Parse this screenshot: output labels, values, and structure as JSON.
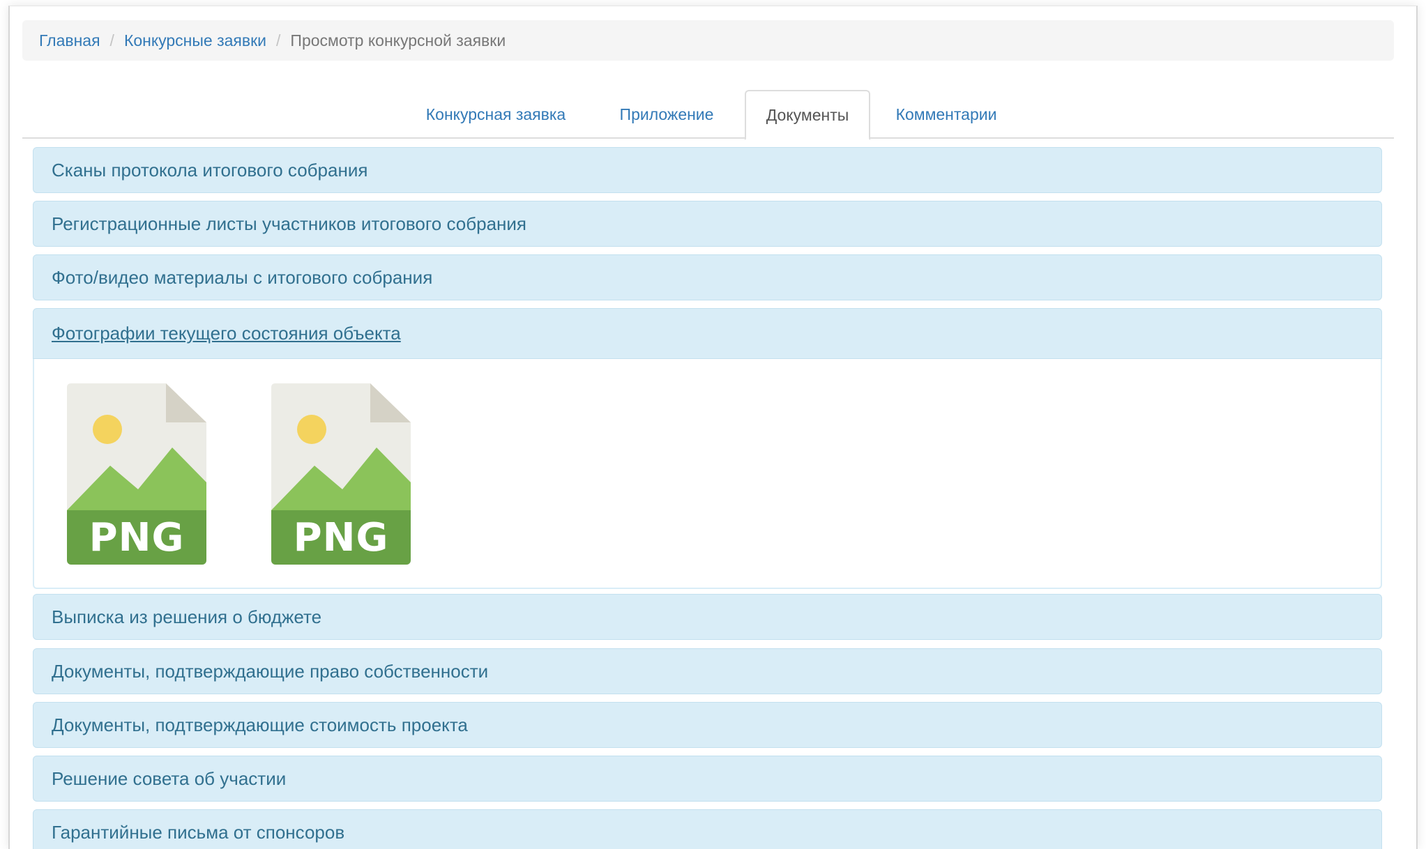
{
  "breadcrumb": {
    "home": "Главная",
    "applications": "Конкурсные заявки",
    "current": "Просмотр конкурсной заявки"
  },
  "tabs": [
    {
      "label": "Конкурсная заявка",
      "active": false
    },
    {
      "label": "Приложение",
      "active": false
    },
    {
      "label": "Документы",
      "active": true
    },
    {
      "label": "Комментарии",
      "active": false
    }
  ],
  "panels": [
    {
      "title": "Сканы протокола итогового собрания"
    },
    {
      "title": "Регистрационные листы участников итогового собрания"
    },
    {
      "title": "Фото/видео материалы с итогового собрания"
    },
    {
      "title": "Фотографии текущего состояния объекта",
      "expanded": true,
      "files": [
        {
          "type": "PNG",
          "icon": "png-file-icon"
        },
        {
          "type": "PNG",
          "icon": "png-file-icon"
        }
      ]
    },
    {
      "title": "Выписка из решения о бюджете"
    },
    {
      "title": "Документы, подтверждающие право собственности"
    },
    {
      "title": "Документы, подтверждающие стоимость проекта"
    },
    {
      "title": "Решение совета об участии"
    },
    {
      "title": "Гарантийные письма от спонсоров"
    }
  ],
  "colors": {
    "link": "#337ab7",
    "panel_bg": "#d9edf7",
    "panel_text": "#31708f",
    "png_green": "#68a145",
    "png_light_green": "#8bc35a",
    "sun_yellow": "#f4d35e"
  }
}
